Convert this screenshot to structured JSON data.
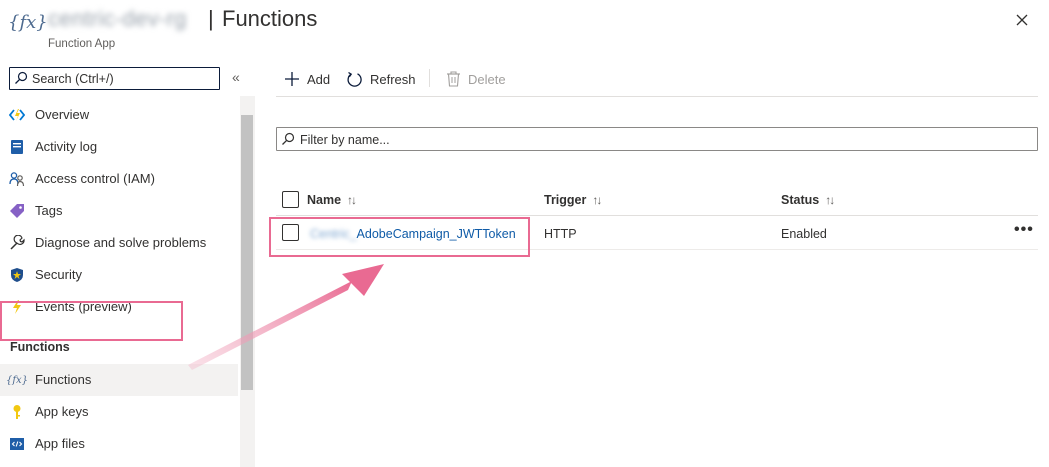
{
  "header": {
    "resource_name": "centric-dev-rg",
    "separator": "|",
    "title": "Functions",
    "subtitle": "Function App",
    "app_icon": "{fx}"
  },
  "sidebar": {
    "search_placeholder": "Search (Ctrl+/)",
    "collapse_glyph": "«",
    "items_top": [
      {
        "label": "Overview",
        "icon": "overview-icon"
      },
      {
        "label": "Activity log",
        "icon": "activity-log-icon"
      },
      {
        "label": "Access control (IAM)",
        "icon": "people-icon"
      },
      {
        "label": "Tags",
        "icon": "tag-icon"
      },
      {
        "label": "Diagnose and solve problems",
        "icon": "wrench-icon"
      },
      {
        "label": "Security",
        "icon": "shield-icon"
      },
      {
        "label": "Events (preview)",
        "icon": "lightning-icon"
      }
    ],
    "section_functions": "Functions",
    "items_functions": [
      {
        "label": "Functions",
        "icon": "function-icon",
        "selected": true
      },
      {
        "label": "App keys",
        "icon": "key-icon"
      },
      {
        "label": "App files",
        "icon": "code-file-icon"
      }
    ]
  },
  "toolbar": {
    "add_label": "Add",
    "refresh_label": "Refresh",
    "delete_label": "Delete"
  },
  "filter": {
    "placeholder": "Filter by name..."
  },
  "table": {
    "columns": [
      "Name",
      "Trigger",
      "Status"
    ],
    "sort_glyph": "↑↓",
    "rows": [
      {
        "name_prefix": "Centric_",
        "name": "AdobeCampaign_JWTToken",
        "trigger": "HTTP",
        "status": "Enabled"
      }
    ],
    "more_glyph": "•••"
  },
  "colors": {
    "highlight": "#e96a92",
    "link": "#0f5ba7",
    "accent": "#0078d4"
  }
}
